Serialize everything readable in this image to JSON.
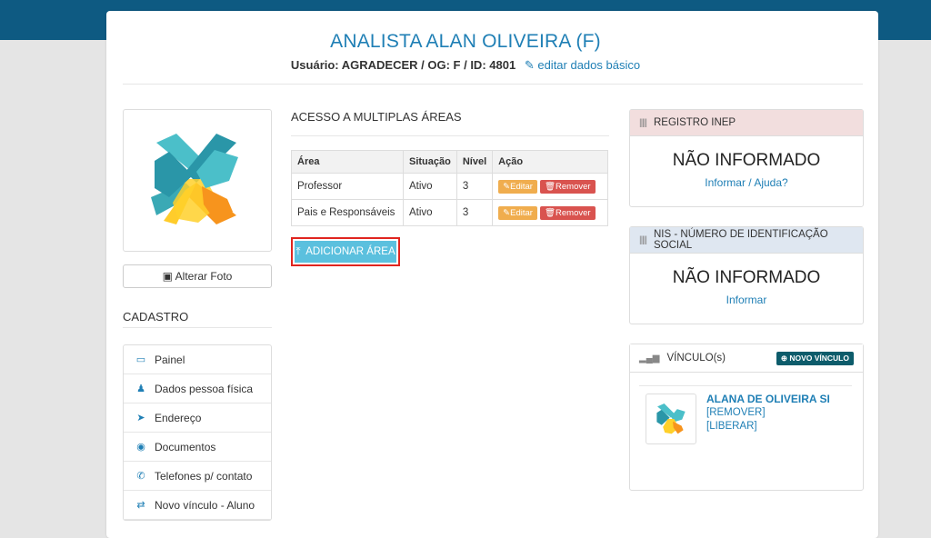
{
  "header": {
    "title": "ANALISTA ALAN OLIVEIRA   (F)",
    "subtitle": "Usuário: AGRADECER / OG: F / ID: 4801",
    "edit_link": "editar dados básico"
  },
  "left": {
    "change_photo": "Alterar Foto",
    "cadastro_title": "CADASTRO",
    "menu": [
      {
        "icon": "monitor-icon",
        "glyph": "▭",
        "label": "Painel"
      },
      {
        "icon": "person-icon",
        "glyph": "♟",
        "label": "Dados pessoa física"
      },
      {
        "icon": "location-arrow-icon",
        "glyph": "➤",
        "label": "Endereço"
      },
      {
        "icon": "circle-dot-icon",
        "glyph": "◉",
        "label": "Documentos"
      },
      {
        "icon": "phone-icon",
        "glyph": "✆",
        "label": "Telefones p/ contato"
      },
      {
        "icon": "refresh-icon",
        "glyph": "⇄",
        "label": "Novo vínculo - Aluno"
      }
    ]
  },
  "center": {
    "section_title": "ACESSO A MULTIPLAS ÁREAS",
    "table": {
      "headers": [
        "Área",
        "Situação",
        "Nível",
        "Ação"
      ],
      "rows": [
        {
          "area": "Professor",
          "situacao": "Ativo",
          "nivel": "3"
        },
        {
          "area": "Pais e Responsáveis",
          "situacao": "Ativo",
          "nivel": "3"
        }
      ],
      "edit_label": "Editar",
      "remove_label": "Remover"
    },
    "add_button": "ADICIONAR ÁREA"
  },
  "right": {
    "inep": {
      "title": "REGISTRO INEP",
      "value": "NÃO INFORMADO",
      "link": "Informar / Ajuda?"
    },
    "nis": {
      "title": "NIS - NÚMERO DE IDENTIFICAÇÃO SOCIAL",
      "value": "NÃO INFORMADO",
      "link": "Informar"
    },
    "vinculo": {
      "title": "VÍNCULO(s)",
      "new_button": "NOVO VÍNCULO",
      "name": "ALANA DE OLIVEIRA SI",
      "remove": "[REMOVER]",
      "liberar": "[LIBERAR]"
    }
  },
  "colors": {
    "topbar": "#0e5a82",
    "accent": "#1f7fb5",
    "edit": "#f0ad4e",
    "remove": "#d9534f",
    "add": "#5bc0de",
    "highlight": "#e0251f"
  }
}
